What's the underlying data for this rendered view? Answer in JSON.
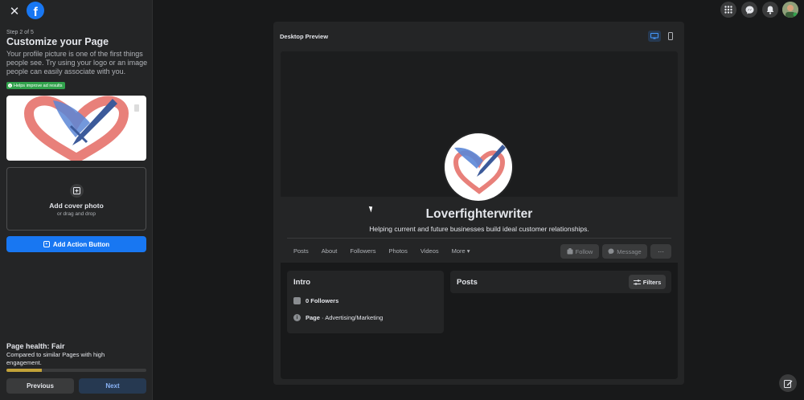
{
  "sidebar": {
    "step": "Step 2 of 5",
    "title": "Customize your Page",
    "description": "Your profile picture is one of the first things people see. Try using your logo or an image people can easily associate with you.",
    "badge": "Helps improve ad results",
    "cover_title": "Add cover photo",
    "cover_sub": "or drag and drop",
    "action_button": "Add Action Button",
    "health_title": "Page health: Fair",
    "health_desc": "Compared to similar Pages with high engagement.",
    "health_progress": 0.25,
    "prev": "Previous",
    "next": "Next"
  },
  "preview": {
    "title": "Desktop Preview",
    "page_name": "Loverfighterwriter",
    "tagline": "Helping current and future businesses build ideal customer relationships.",
    "tabs": [
      "Posts",
      "About",
      "Followers",
      "Photos",
      "Videos",
      "More ▾"
    ],
    "follow": "Follow",
    "message": "Message",
    "more": "···",
    "intro_title": "Intro",
    "followers": "0 Followers",
    "category_label": "Page",
    "category_value": " · Advertising/Marketing",
    "posts_title": "Posts",
    "filters": "Filters"
  },
  "colors": {
    "accent": "#1877f2",
    "badge_green": "#31a24c",
    "health_yellow": "#c2a239",
    "heart": "#e8807a",
    "quill": "#5b86d6"
  },
  "icons": [
    "close-icon",
    "facebook-logo-icon",
    "grid-menu-icon",
    "messenger-icon",
    "bell-icon",
    "desktop-icon",
    "mobile-icon",
    "edit-icon"
  ]
}
